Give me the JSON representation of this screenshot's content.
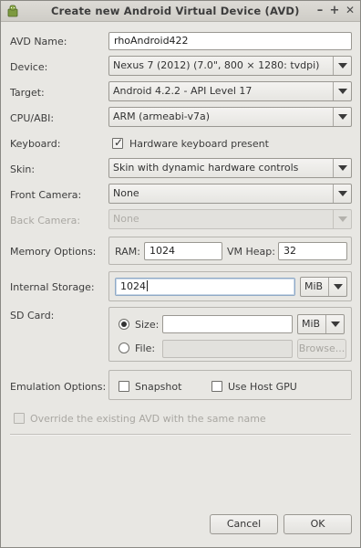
{
  "window": {
    "title": "Create new Android Virtual Device (AVD)",
    "controls": {
      "minimize": "–",
      "maximize": "+",
      "close": "✕"
    }
  },
  "fields": {
    "avd_name": {
      "label": "AVD Name:",
      "value": "rhoAndroid422"
    },
    "device": {
      "label": "Device:",
      "value": "Nexus 7 (2012) (7.0\", 800 × 1280: tvdpi)"
    },
    "target": {
      "label": "Target:",
      "value": "Android 4.2.2 - API Level 17"
    },
    "cpu_abi": {
      "label": "CPU/ABI:",
      "value": "ARM (armeabi-v7a)"
    },
    "keyboard": {
      "label": "Keyboard:",
      "checkbox_label": "Hardware keyboard present",
      "checked": true
    },
    "skin": {
      "label": "Skin:",
      "value": "Skin with dynamic hardware controls"
    },
    "front_camera": {
      "label": "Front Camera:",
      "value": "None"
    },
    "back_camera": {
      "label": "Back Camera:",
      "value": "None"
    },
    "memory": {
      "label": "Memory Options:",
      "ram_label": "RAM:",
      "ram_value": "1024",
      "vm_heap_label": "VM Heap:",
      "vm_heap_value": "32"
    },
    "internal_storage": {
      "label": "Internal Storage:",
      "value": "1024",
      "unit": "MiB"
    },
    "sd_card": {
      "label": "SD Card:",
      "size_label": "Size:",
      "size_value": "",
      "size_unit": "MiB",
      "size_selected": true,
      "file_label": "File:",
      "file_value": "",
      "browse_label": "Browse..."
    },
    "emulation": {
      "label": "Emulation Options:",
      "snapshot_label": "Snapshot",
      "snapshot_checked": false,
      "host_gpu_label": "Use Host GPU",
      "host_gpu_checked": false
    },
    "override": {
      "label": "Override the existing AVD with the same name",
      "checked": false
    }
  },
  "buttons": {
    "cancel": "Cancel",
    "ok": "OK"
  },
  "colors": {
    "window_bg": "#e8e7e3",
    "titlebar": "#d6d4cf",
    "text": "#3c3c3c",
    "disabled_text": "#a9a7a2",
    "border": "#9a9892"
  }
}
